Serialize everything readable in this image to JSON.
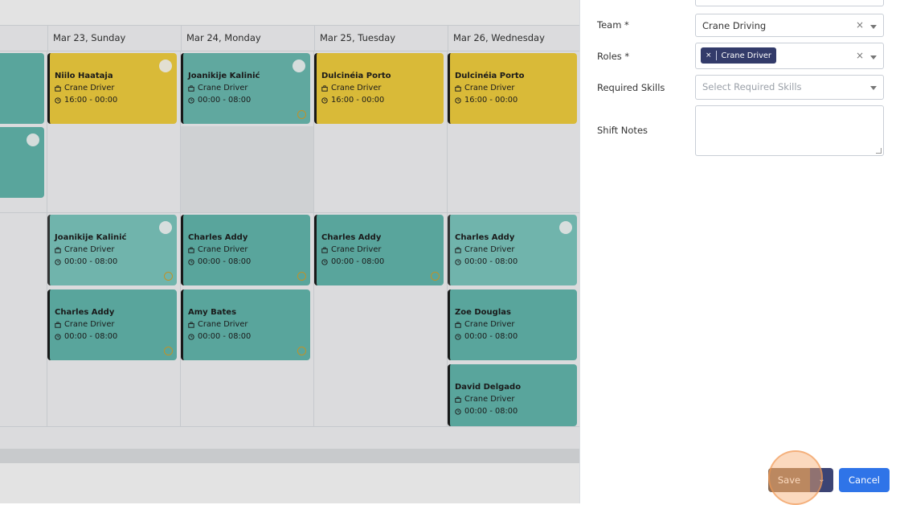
{
  "calendar": {
    "days": [
      {
        "label": "Mar 23, Sunday"
      },
      {
        "label": "Mar 24, Monday"
      },
      {
        "label": "Mar 25, Tuesday"
      },
      {
        "label": "Mar 26, Wednesday"
      }
    ],
    "shifts": [
      {
        "name": "Niilo Haataja",
        "role": "Crane Driver",
        "time": "16:00 - 00:00"
      },
      {
        "name": "Joanikije Kalinić",
        "role": "Crane Driver",
        "time": "00:00 - 08:00"
      },
      {
        "name": "Dulcinéia Porto",
        "role": "Crane Driver",
        "time": "16:00 - 00:00"
      },
      {
        "name": "Dulcinéia Porto",
        "role": "Crane Driver",
        "time": "16:00 - 00:00"
      },
      {
        "name": "Joanikije Kalinić",
        "role": "Crane Driver",
        "time": "00:00 - 08:00"
      },
      {
        "name": "Charles Addy",
        "role": "Crane Driver",
        "time": "00:00 - 08:00"
      },
      {
        "name": "Charles Addy",
        "role": "Crane Driver",
        "time": "00:00 - 08:00"
      },
      {
        "name": "Charles Addy",
        "role": "Crane Driver",
        "time": "00:00 - 08:00"
      },
      {
        "name": "Charles Addy",
        "role": "Crane Driver",
        "time": "00:00 - 08:00"
      },
      {
        "name": "Amy Bates",
        "role": "Crane Driver",
        "time": "00:00 - 08:00"
      },
      {
        "name": "Zoe Douglas",
        "role": "Crane Driver",
        "time": "00:00 - 08:00"
      },
      {
        "name": "David Delgado",
        "role": "Crane Driver",
        "time": "00:00 - 08:00"
      }
    ]
  },
  "form": {
    "team_label": "Team *",
    "team_value": "Crane Driving",
    "roles_label": "Roles *",
    "roles_chip": "Crane Driver",
    "skills_label": "Required Skills",
    "skills_placeholder": "Select Required Skills",
    "notes_label": "Shift Notes",
    "clear_glyph": "×"
  },
  "buttons": {
    "save": "Save",
    "cancel": "Cancel"
  },
  "colors": {
    "shift_yellow": "#f4d13f",
    "shift_teal": "#64bab0",
    "save_bg": "#8a6c55",
    "cancel_bg": "#2f74e8",
    "chip_bg": "#333b6a"
  }
}
